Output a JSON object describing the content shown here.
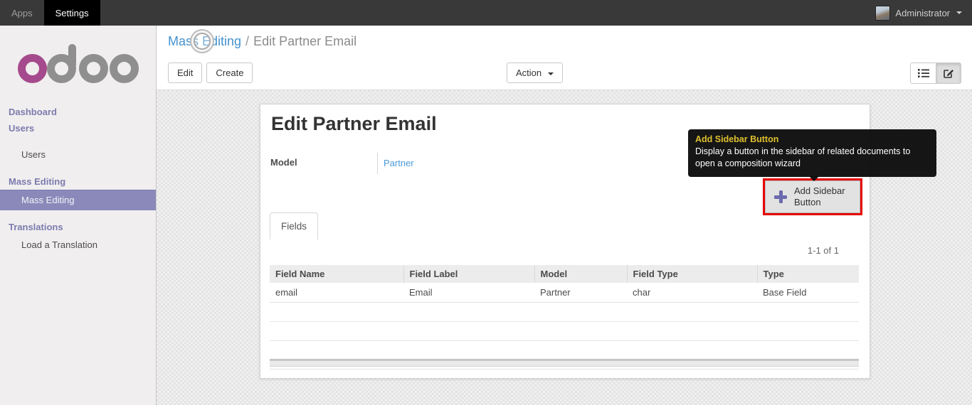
{
  "topbar": {
    "menus": [
      {
        "label": "Apps"
      },
      {
        "label": "Settings"
      }
    ],
    "user": {
      "name": "Administrator"
    }
  },
  "sidebar": {
    "logo_text": "odoo",
    "sections": [
      {
        "header": "Dashboard"
      },
      {
        "header": "Users",
        "items": [
          {
            "label": "Users"
          }
        ]
      },
      {
        "header": "Mass Editing",
        "items": [
          {
            "label": "Mass Editing",
            "selected": true
          }
        ]
      },
      {
        "header": "Translations",
        "items": [
          {
            "label": "Load a Translation"
          }
        ]
      }
    ]
  },
  "breadcrumb": {
    "parent": "Mass Editing",
    "separator": "/",
    "current": "Edit Partner Email"
  },
  "control_panel": {
    "edit_label": "Edit",
    "create_label": "Create",
    "action_label": "Action",
    "view_switcher": [
      {
        "name": "list",
        "active": false
      },
      {
        "name": "form",
        "active": true
      }
    ]
  },
  "form": {
    "title": "Edit Partner Email",
    "model_label": "Model",
    "model_value": "Partner",
    "add_sidebar_button_label": "Add Sidebar Button",
    "tab_label": "Fields",
    "pager": "1-1 of 1"
  },
  "tooltip": {
    "title": "Add Sidebar Button",
    "body": "Display a button in the sidebar of related documents to open a composition wizard"
  },
  "table": {
    "headers": [
      "Field Name",
      "Field Label",
      "Model",
      "Field Type",
      "Type"
    ],
    "rows": [
      [
        "email",
        "Email",
        "Partner",
        "char",
        "Base Field"
      ]
    ]
  },
  "colors": {
    "accent_purple": "#7c7bad",
    "selected_purple": "#8a89ba",
    "link_blue": "#4592cd",
    "tooltip_title_gold": "#dfc02f",
    "annotation_red": "#e60000",
    "logo_magenta": "#a54a8c"
  }
}
